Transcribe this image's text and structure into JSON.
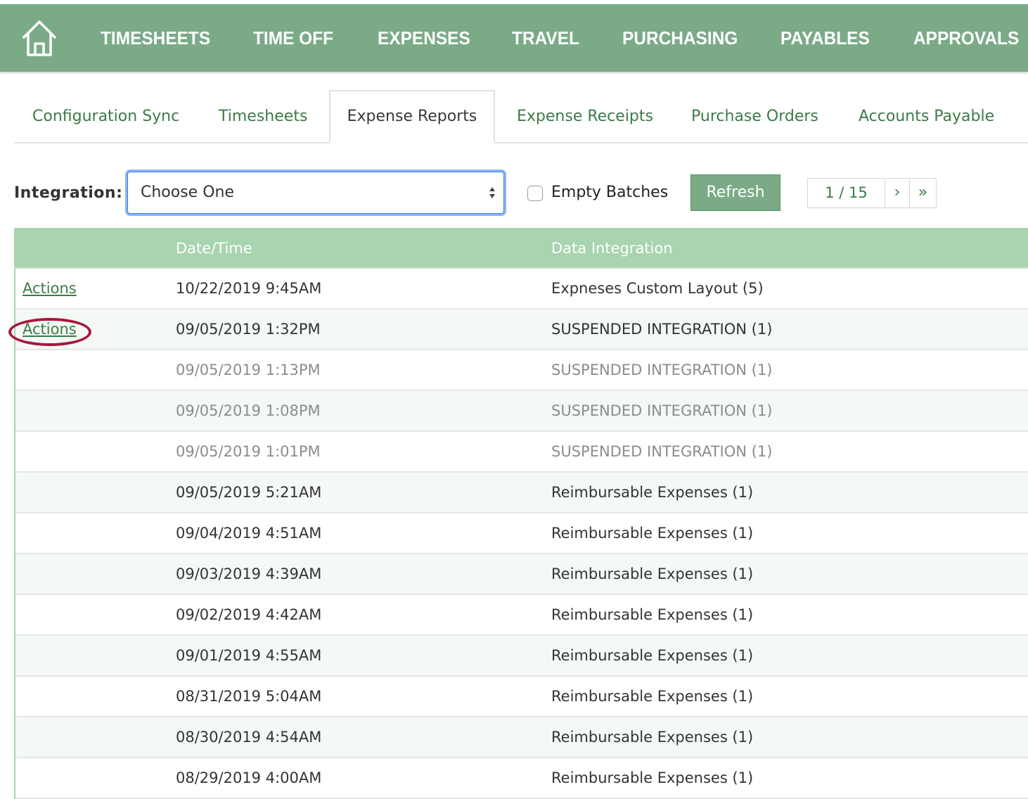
{
  "nav": {
    "items": [
      {
        "label": "TIMESHEETS"
      },
      {
        "label": "TIME OFF"
      },
      {
        "label": "EXPENSES"
      },
      {
        "label": "TRAVEL"
      },
      {
        "label": "PURCHASING"
      },
      {
        "label": "PAYABLES"
      },
      {
        "label": "APPROVALS"
      }
    ]
  },
  "tabs": [
    {
      "label": "Configuration Sync",
      "active": false
    },
    {
      "label": "Timesheets",
      "active": false
    },
    {
      "label": "Expense Reports",
      "active": true
    },
    {
      "label": "Expense Receipts",
      "active": false
    },
    {
      "label": "Purchase Orders",
      "active": false
    },
    {
      "label": "Accounts Payable",
      "active": false
    }
  ],
  "filter": {
    "integration_label": "Integration:",
    "integration_value": "Choose One",
    "empty_batches_label": "Empty Batches",
    "empty_batches_checked": false,
    "refresh_label": "Refresh"
  },
  "pager": {
    "page_display": "1 / 15",
    "next_label": "›",
    "last_label": "»"
  },
  "table": {
    "columns": [
      "",
      "Date/Time",
      "Data Integration"
    ],
    "rows": [
      {
        "action": "Actions",
        "datetime": "10/22/2019 9:45AM",
        "integration": "Expneses Custom Layout (5)",
        "dim": false
      },
      {
        "action": "Actions",
        "datetime": "09/05/2019 1:32PM",
        "integration": "SUSPENDED INTEGRATION (1)",
        "dim": false
      },
      {
        "action": "",
        "datetime": "09/05/2019 1:13PM",
        "integration": "SUSPENDED INTEGRATION (1)",
        "dim": true
      },
      {
        "action": "",
        "datetime": "09/05/2019 1:08PM",
        "integration": "SUSPENDED INTEGRATION (1)",
        "dim": true
      },
      {
        "action": "",
        "datetime": "09/05/2019 1:01PM",
        "integration": "SUSPENDED INTEGRATION (1)",
        "dim": true
      },
      {
        "action": "",
        "datetime": "09/05/2019 5:21AM",
        "integration": "Reimbursable Expenses (1)",
        "dim": false
      },
      {
        "action": "",
        "datetime": "09/04/2019 4:51AM",
        "integration": "Reimbursable Expenses (1)",
        "dim": false
      },
      {
        "action": "",
        "datetime": "09/03/2019 4:39AM",
        "integration": "Reimbursable Expenses (1)",
        "dim": false
      },
      {
        "action": "",
        "datetime": "09/02/2019 4:42AM",
        "integration": "Reimbursable Expenses (1)",
        "dim": false
      },
      {
        "action": "",
        "datetime": "09/01/2019 4:55AM",
        "integration": "Reimbursable Expenses (1)",
        "dim": false
      },
      {
        "action": "",
        "datetime": "08/31/2019 5:04AM",
        "integration": "Reimbursable Expenses (1)",
        "dim": false
      },
      {
        "action": "",
        "datetime": "08/30/2019 4:54AM",
        "integration": "Reimbursable Expenses (1)",
        "dim": false
      },
      {
        "action": "",
        "datetime": "08/29/2019 4:00AM",
        "integration": "Reimbursable Expenses (1)",
        "dim": false
      }
    ]
  },
  "colors": {
    "nav_bg": "#7aab86",
    "header_bg": "#a8d4b0",
    "link": "#3d7a47",
    "highlight_circle": "#a8173e"
  }
}
